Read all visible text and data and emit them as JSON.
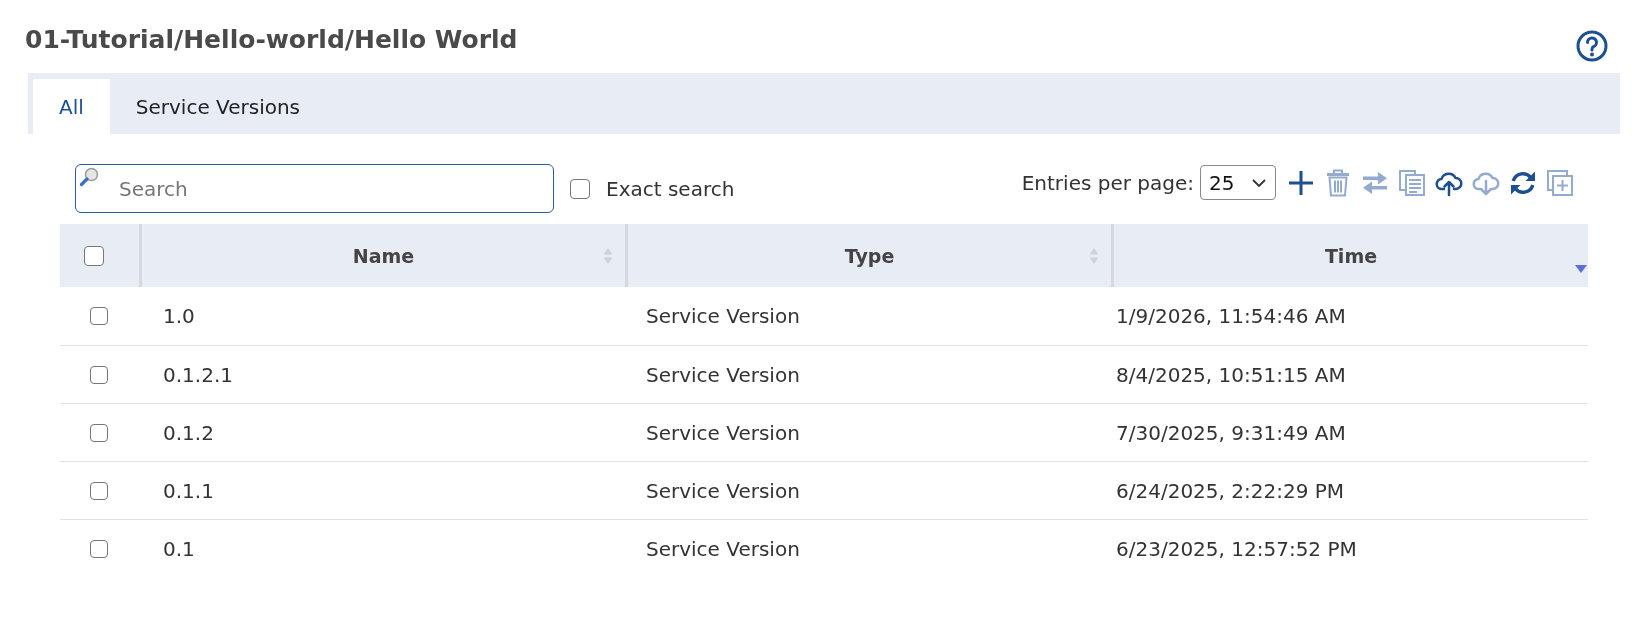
{
  "page": {
    "title": "01-Tutorial/Hello-world/Hello World"
  },
  "tabs": [
    {
      "label": "All",
      "selected": true
    },
    {
      "label": "Service Versions",
      "selected": false
    }
  ],
  "search": {
    "placeholder": "Search"
  },
  "exact_search": {
    "label": "Exact search",
    "checked": false
  },
  "entries_per_page": {
    "label": "Entries per page:",
    "value": "25"
  },
  "toolbar_actions": [
    {
      "kind": "add",
      "disabled": false
    },
    {
      "kind": "delete",
      "disabled": true
    },
    {
      "kind": "transfer",
      "disabled": true
    },
    {
      "kind": "copy",
      "disabled": true
    },
    {
      "kind": "upload",
      "disabled": false
    },
    {
      "kind": "download",
      "disabled": true
    },
    {
      "kind": "refresh",
      "disabled": false
    },
    {
      "kind": "expand",
      "disabled": true
    }
  ],
  "table": {
    "select_all": {
      "checked": false
    },
    "columns": [
      {
        "label": "Name",
        "sorted_descending": false
      },
      {
        "label": "Type",
        "sorted_descending": false
      },
      {
        "label": "Time",
        "sorted_descending": true
      }
    ],
    "rows": [
      {
        "checked": false,
        "cells": [
          "1.0",
          "Service Version",
          "1/9/2026, 11:54:46 AM"
        ]
      },
      {
        "checked": false,
        "cells": [
          "0.1.2.1",
          "Service Version",
          "8/4/2025, 10:51:15 AM"
        ]
      },
      {
        "checked": false,
        "cells": [
          "0.1.2",
          "Service Version",
          "7/30/2025, 9:31:49 AM"
        ]
      },
      {
        "checked": false,
        "cells": [
          "0.1.1",
          "Service Version",
          "6/24/2025, 2:22:29 PM"
        ]
      },
      {
        "checked": false,
        "cells": [
          "0.1",
          "Service Version",
          "6/23/2025, 12:57:52 PM"
        ]
      }
    ]
  }
}
